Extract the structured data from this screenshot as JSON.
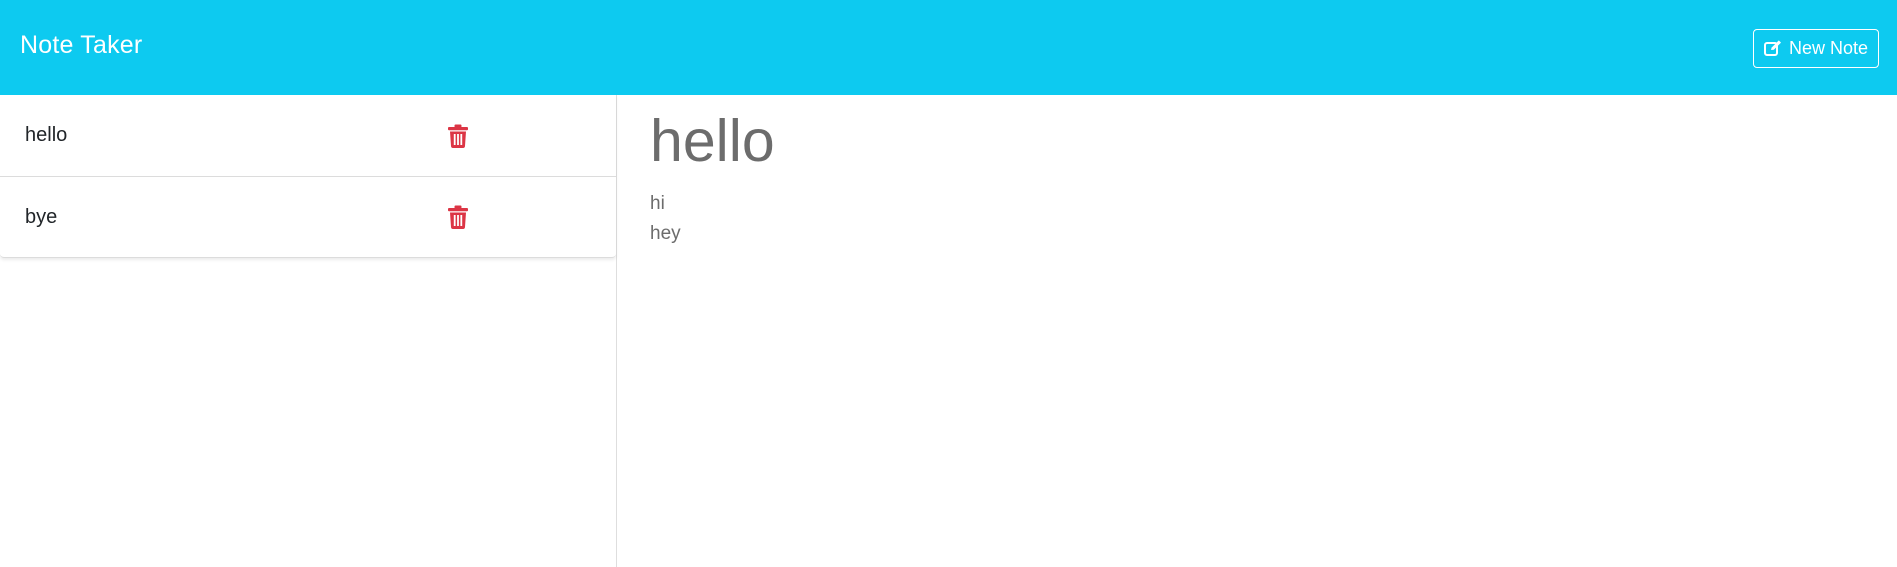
{
  "app": {
    "title": "Note Taker"
  },
  "toolbar": {
    "new_note_label": "New Note",
    "new_note_icon": "pen-to-square-icon"
  },
  "notes": [
    {
      "title": "hello",
      "delete_icon": "trash-icon"
    },
    {
      "title": "bye",
      "delete_icon": "trash-icon"
    }
  ],
  "active_note": {
    "title": "hello",
    "lines": [
      "hi",
      "hey"
    ]
  },
  "colors": {
    "navbar": "#0dcaf0",
    "delete": "#dc3545",
    "note_text": "#6c6c6c"
  }
}
